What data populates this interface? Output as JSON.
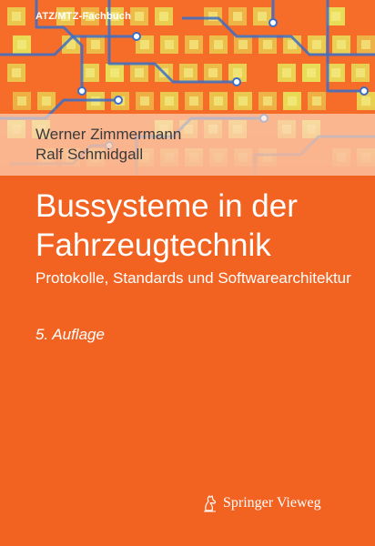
{
  "cover": {
    "series": "ATZ/MTZ-Fachbuch",
    "authors": [
      "Werner Zimmermann",
      "Ralf Schmidgall"
    ],
    "title_lines": [
      "Bussysteme in der",
      "Fahrzeugtechnik"
    ],
    "subtitle": "Protokolle, Standards und Softwarearchitektur",
    "edition": "5. Auflage",
    "publisher": "Springer Vieweg",
    "publisher_logo_icon": "springer-horse-icon",
    "colors": {
      "background": "#f26322",
      "art_pads": "#e8e35a",
      "art_traces": "#3a6fc8",
      "author_text": "#3a3a3a",
      "title_text": "#ffffff"
    }
  }
}
